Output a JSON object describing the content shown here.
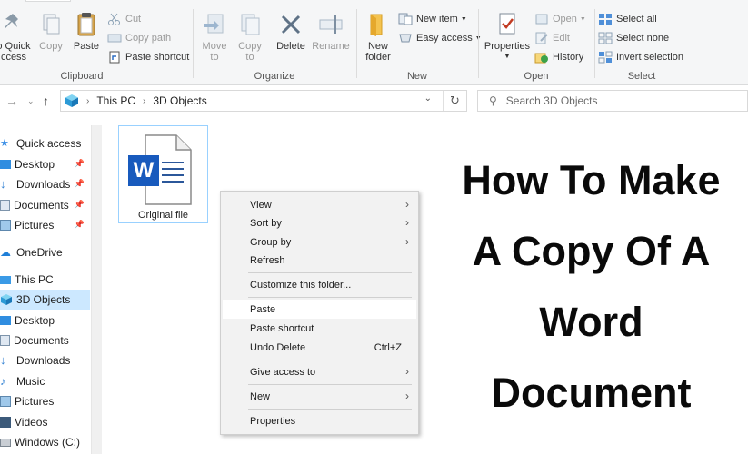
{
  "ribbon": {
    "clipboard": {
      "label": "Clipboard",
      "pin_quick_access_label_1": "o Quick",
      "pin_quick_access_label_2": "ccess",
      "copy_label": "Copy",
      "paste_label": "Paste",
      "cut_label": "Cut",
      "copy_path_label": "Copy path",
      "paste_shortcut_label": "Paste shortcut"
    },
    "organize": {
      "label": "Organize",
      "move_to_1": "Move",
      "move_to_2": "to",
      "copy_to_1": "Copy",
      "copy_to_2": "to",
      "delete_label": "Delete",
      "rename_label": "Rename"
    },
    "new": {
      "label": "New",
      "new_folder_1": "New",
      "new_folder_2": "folder",
      "new_item_label": "New item",
      "easy_access_label": "Easy access"
    },
    "open": {
      "label": "Open",
      "properties_label": "Properties",
      "open_label": "Open",
      "edit_label": "Edit",
      "history_label": "History"
    },
    "select": {
      "label": "Select",
      "select_all_label": "Select all",
      "select_none_label": "Select none",
      "invert_selection_label": "Invert selection"
    }
  },
  "address": {
    "crumbs": [
      "This PC",
      "3D Objects"
    ],
    "search_placeholder": "Search 3D Objects"
  },
  "nav": {
    "quick_access": "Quick access",
    "desktop": "Desktop",
    "downloads": "Downloads",
    "documents": "Documents",
    "pictures": "Pictures",
    "onedrive": "OneDrive",
    "this_pc": "This PC",
    "objects3d": "3D Objects",
    "desktop2": "Desktop",
    "documents2": "Documents",
    "downloads2": "Downloads",
    "music": "Music",
    "pictures2": "Pictures",
    "videos": "Videos",
    "windows_c": "Windows (C:)"
  },
  "file": {
    "name": "Original file",
    "icon_letter": "W"
  },
  "context_menu": {
    "view": "View",
    "sort_by": "Sort by",
    "group_by": "Group by",
    "refresh": "Refresh",
    "customize": "Customize this folder...",
    "paste": "Paste",
    "paste_shortcut": "Paste shortcut",
    "undo_delete": "Undo Delete",
    "undo_shortcut": "Ctrl+Z",
    "give_access": "Give access to",
    "new": "New",
    "properties": "Properties"
  },
  "headline": {
    "line1": "How To Make",
    "line2": "A Copy Of A",
    "line3": "Word",
    "line4": "Document"
  },
  "colors": {
    "selection": "#cce8ff",
    "word_blue": "#185abd",
    "ribbon_bg": "#f5f6f7"
  }
}
